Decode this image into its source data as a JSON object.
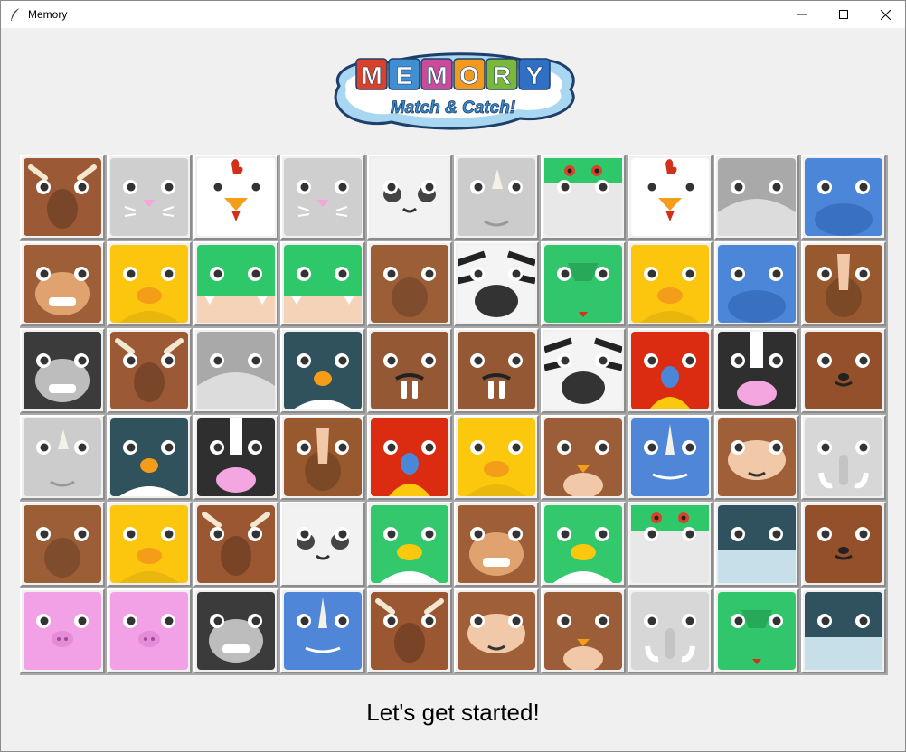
{
  "window": {
    "title": "Memory"
  },
  "logo": {
    "title": "MEMORY",
    "letters": [
      "M",
      "E",
      "M",
      "O",
      "R",
      "Y"
    ],
    "letter_colors": [
      "#d9412b",
      "#3f8fd2",
      "#c94b9a",
      "#f29a1d",
      "#7ab83a",
      "#2f6fc4"
    ],
    "subtitle": "Match & Catch!"
  },
  "status": {
    "text": "Let's get started!"
  },
  "board": {
    "rows": 6,
    "cols": 10,
    "tiles": [
      [
        "bull",
        "cat",
        "chicken",
        "cat",
        "panda",
        "rhino",
        "frog",
        "chicken",
        "penguin",
        "hippo"
      ],
      [
        "monkey",
        "chick",
        "crocodile",
        "crocodile",
        "horse",
        "zebra",
        "dragon",
        "chick",
        "hippo",
        "horse-stripe"
      ],
      [
        "gorilla",
        "bull",
        "penguin",
        "puffin",
        "walrus",
        "walrus",
        "zebra",
        "parrot",
        "cow",
        "bear"
      ],
      [
        "rhino",
        "puffin",
        "cow",
        "horse-stripe",
        "parrot",
        "duck",
        "owl",
        "narwhal",
        "sloth",
        "elephant"
      ],
      [
        "horse",
        "chick",
        "moose",
        "panda",
        "duck-green",
        "monkey",
        "duck-green",
        "frog",
        "whale",
        "bear"
      ],
      [
        "pig",
        "pig",
        "gorilla",
        "narwhal",
        "moose",
        "sloth",
        "owl",
        "elephant",
        "dragon",
        "whale"
      ]
    ]
  },
  "palette": {
    "bull": "#9b5a35",
    "cat": "#cfcfcf",
    "chicken": "#ffffff",
    "panda": "#f2f2f2",
    "rhino": "#cccccc",
    "frog": "#e8e8e8",
    "penguin": "#a9a9a9",
    "hippo": "#4b86d8",
    "monkey": "#9e5f38",
    "chick": "#fcc60e",
    "crocodile": "#2ec86b",
    "horse": "#9c5e37",
    "zebra": "#f4f4f4",
    "dragon": "#31c66c",
    "horse-stripe": "#98592f",
    "gorilla": "#3b3b3b",
    "puffin": "#30525c",
    "walrus": "#955835",
    "parrot": "#db2b10",
    "cow": "#2f2f2f",
    "bear": "#944f2b",
    "duck": "#fcc80e",
    "owl": "#9b5e38",
    "narwhal": "#4f86d8",
    "sloth": "#9e5f39",
    "elephant": "#d7d7d7",
    "moose": "#9a5731",
    "duck-green": "#33c86c",
    "whale": "#30525e",
    "pig": "#f2a1e6"
  }
}
